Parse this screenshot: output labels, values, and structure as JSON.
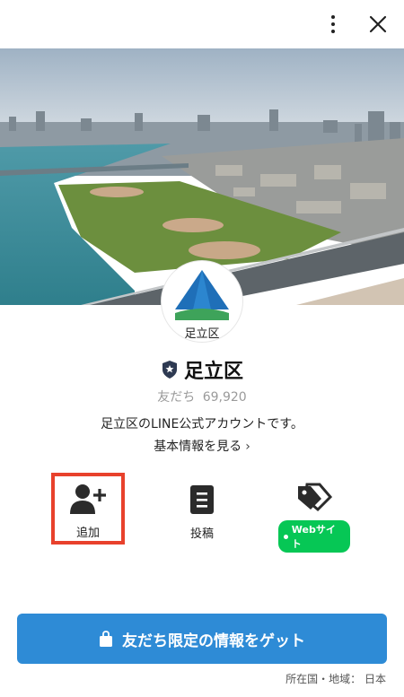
{
  "topbar": {
    "menu_icon": "more-vertical-icon",
    "close_icon": "close-icon"
  },
  "cover": {
    "description_icon": "cityscape-river-photo"
  },
  "profile": {
    "logo_label": "足立区",
    "badge_icon": "verified-shield-icon",
    "name": "足立区",
    "friends_label": "友だち",
    "friends_count": "69,920",
    "description": "足立区のLINE公式アカウントです。",
    "more_info": "基本情報を見る",
    "more_info_icon": "chevron-right-icon"
  },
  "actions": {
    "add_label": "追加",
    "add_icon": "add-friend-icon",
    "post_label": "投稿",
    "post_icon": "post-icon",
    "web_label": "Webサイト",
    "web_icon": "tag-icon"
  },
  "cta": {
    "label": "友だち限定の情報をゲット",
    "icon": "shopping-bag-icon"
  },
  "footer": {
    "country": "所在国・地域： 日本"
  },
  "colors": {
    "accent": "#06c755",
    "cta": "#2e8bd6",
    "highlight": "#e8412c"
  }
}
